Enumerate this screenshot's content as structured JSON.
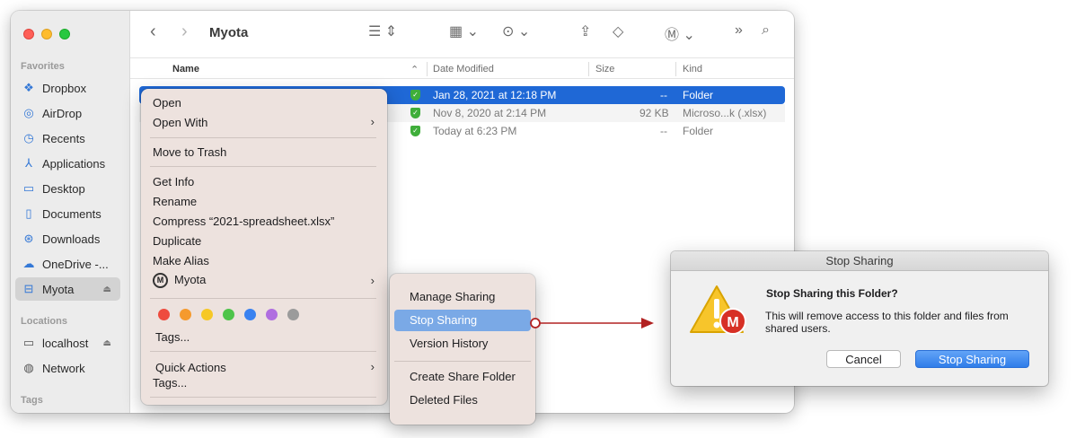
{
  "window": {
    "title": "Myota"
  },
  "sidebar": {
    "favorites_header": "Favorites",
    "locations_header": "Locations",
    "tags_header": "Tags",
    "favorites": [
      {
        "label": "Dropbox",
        "icon": "dropbox-icon"
      },
      {
        "label": "AirDrop",
        "icon": "airdrop-icon"
      },
      {
        "label": "Recents",
        "icon": "clock-icon"
      },
      {
        "label": "Applications",
        "icon": "applications-icon"
      },
      {
        "label": "Desktop",
        "icon": "desktop-icon"
      },
      {
        "label": "Documents",
        "icon": "document-icon"
      },
      {
        "label": "Downloads",
        "icon": "download-icon"
      },
      {
        "label": "OneDrive -...",
        "icon": "cloud-icon"
      },
      {
        "label": "Myota",
        "icon": "drive-icon",
        "selected": true
      }
    ],
    "locations": [
      {
        "label": "localhost",
        "icon": "computer-icon"
      },
      {
        "label": "Network",
        "icon": "globe-icon"
      }
    ]
  },
  "columns": {
    "name": "Name",
    "date_modified": "Date Modified",
    "size": "Size",
    "kind": "Kind"
  },
  "files": [
    {
      "date": "Jan 28, 2021 at 12:18 PM",
      "size": "--",
      "kind": "Folder",
      "selected": true
    },
    {
      "date": "Nov 8, 2020 at 2:14 PM",
      "size": "92 KB",
      "kind": "Microso...k (.xlsx)"
    },
    {
      "date": "Today at 6:23 PM",
      "size": "--",
      "kind": "Folder"
    }
  ],
  "context_menu": {
    "open": "Open",
    "open_with": "Open With",
    "move_to_trash": "Move to Trash",
    "get_info": "Get Info",
    "rename": "Rename",
    "compress": "Compress “2021-spreadsheet.xlsx”",
    "duplicate": "Duplicate",
    "make_alias": "Make Alias",
    "myota": "Myota",
    "tags": "Tags...",
    "quick_actions": "Quick Actions",
    "tags_bottom": "Tags...",
    "tag_colors": [
      "#ee4b3e",
      "#f59a2d",
      "#f6c826",
      "#4ec44a",
      "#3a82f0",
      "#b06ee0",
      "#9b9b9b"
    ]
  },
  "submenu": {
    "manage_sharing": "Manage Sharing",
    "stop_sharing": "Stop Sharing",
    "version_history": "Version History",
    "create_share_folder": "Create Share Folder",
    "deleted_files": "Deleted Files"
  },
  "dialog": {
    "title": "Stop Sharing",
    "heading": "Stop Sharing this Folder?",
    "message": "This will remove access to this folder and files from shared users.",
    "cancel_label": "Cancel",
    "confirm_label": "Stop Sharing"
  },
  "colors": {
    "selection_blue": "#1f68d6",
    "arrow_red": "#b22222",
    "menu_bg": "#ede2de"
  }
}
